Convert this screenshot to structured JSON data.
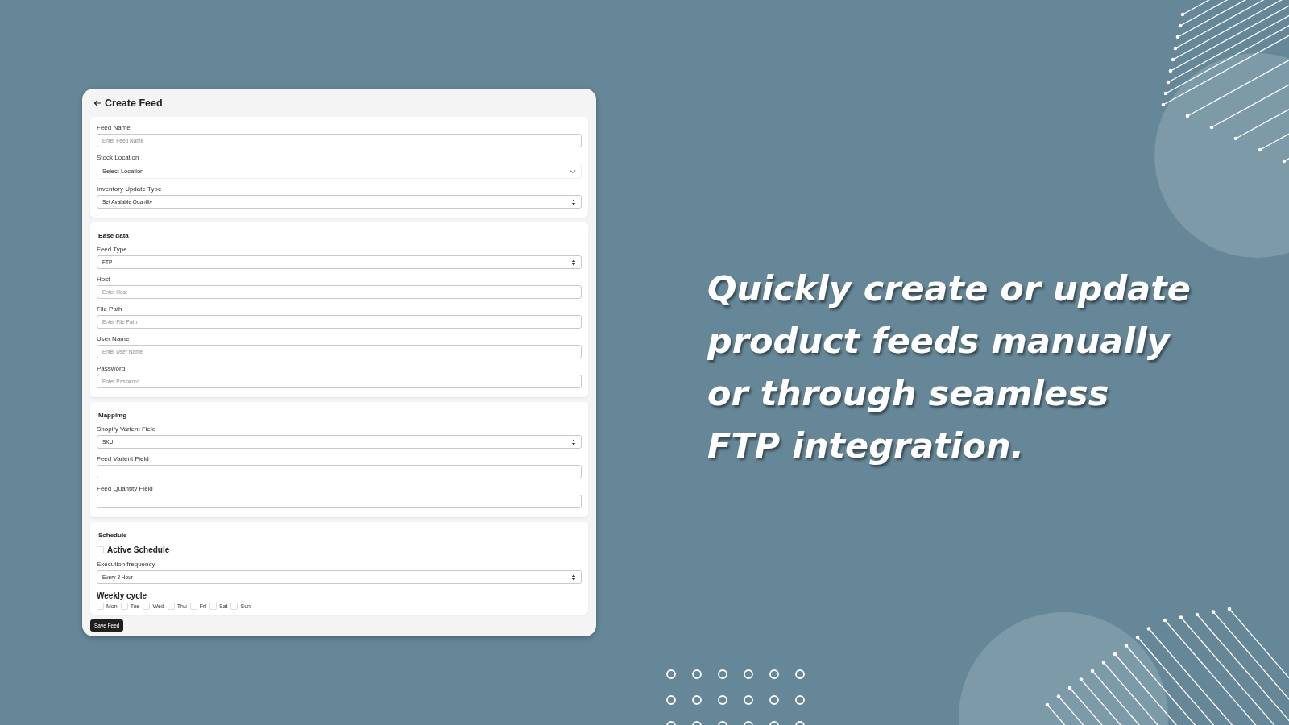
{
  "header": {
    "title": "Create Feed"
  },
  "sections": [
    {
      "fields": [
        {
          "kind": "text",
          "label": "Feed Name",
          "placeholder": "Enter Feed  Name"
        },
        {
          "kind": "dropdown",
          "label": "Stock Location",
          "value": "Select Location"
        },
        {
          "kind": "select",
          "label": "Inventory Update Type",
          "value": "Set Avalable Quantity"
        }
      ]
    },
    {
      "title": "Base data",
      "fields": [
        {
          "kind": "select",
          "label": "Feed Type",
          "value": "FTP"
        },
        {
          "kind": "text",
          "label": "Host",
          "placeholder": "Enter Host"
        },
        {
          "kind": "text",
          "label": "File Path",
          "placeholder": "Enter File Path"
        },
        {
          "kind": "text",
          "label": "User Name",
          "placeholder": "Enter User Name"
        },
        {
          "kind": "text",
          "label": "Password",
          "placeholder": "Enter Password"
        }
      ]
    },
    {
      "title": "Mappimg",
      "fields": [
        {
          "kind": "select",
          "label": "Shopify Varient Field",
          "value": "SKU"
        },
        {
          "kind": "text",
          "label": "Feed Varient Field"
        },
        {
          "kind": "text",
          "label": "Feed Quantity Field"
        }
      ]
    },
    {
      "title": "Schedule",
      "fields": [
        {
          "kind": "checkbox",
          "label": "Active Schedule",
          "checked": false
        },
        {
          "kind": "select",
          "label": "Execution frequency",
          "value": "Every 2 Hour"
        },
        {
          "kind": "days",
          "label": "Weekly cycle",
          "days": [
            {
              "label": "Mon",
              "checked": false
            },
            {
              "label": "Tue",
              "checked": false
            },
            {
              "label": "Wed",
              "checked": false
            },
            {
              "label": "Thu",
              "checked": false
            },
            {
              "label": "Fri",
              "checked": false
            },
            {
              "label": "Sat",
              "checked": false
            },
            {
              "label": "Sun",
              "checked": false
            }
          ]
        }
      ]
    }
  ],
  "save_button": "Save Feed",
  "headline": "Quickly create or update product feeds manually or through seamless FTP integration."
}
